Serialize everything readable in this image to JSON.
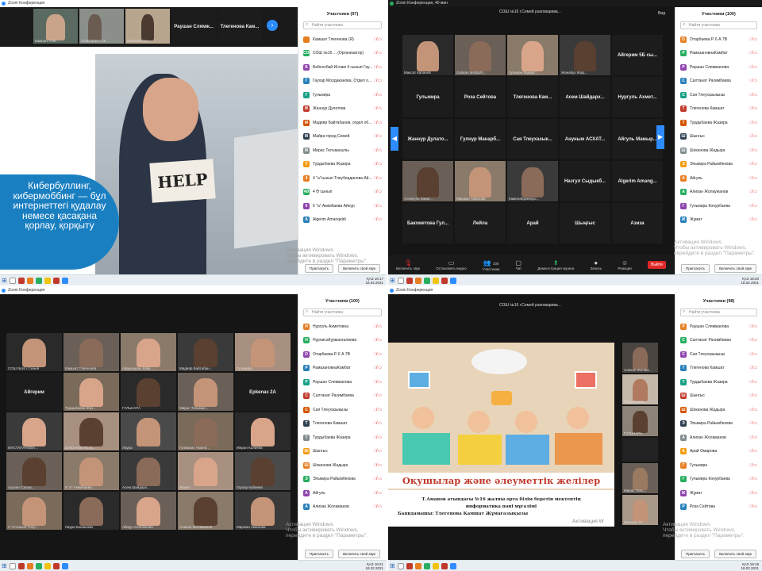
{
  "q1": {
    "title": "Zoom Конференция",
    "strip": [
      "Камшат Тлег...",
      "СОШ №16 г.Се...",
      "Исатаев Сул..."
    ],
    "strip_names": [
      "Раушан Слямж...",
      "Тлегенова Кам..."
    ],
    "slide_text": "Кибербуллинг, кибермоббинг — бұл интернеттегі қудалау немесе қасақана қорлау, қорқыту",
    "help": "HELP",
    "panel_title": "Участники (97)",
    "search": "Найти участника",
    "participants": [
      "Камшат Тлегенова (Я)",
      "СОШ №16 ... (Организатор)",
      "Бейсенбай Ислам 4 сынып Гау...",
      "Гаухар Молдаканова, Отдел о...",
      "Гульмира",
      "Жаннур Дулатова",
      "Мадияр Байтабанов, отдел об...",
      "Майра город Семей",
      "Мирас Телъманулы",
      "Турдыбаева Жазира",
      "4 \"а\"сынып Тлеубердинова Ай...",
      "4 Ә сынып",
      "6 \"а\" Акимбаева Айнур",
      "Algerim Amanqeldi"
    ],
    "avatars": [
      "",
      "СОШ",
      "Б",
      "Г",
      "Г",
      "Ж",
      "М",
      "М",
      "М",
      "Т",
      "4",
      "4Ә",
      "6",
      "А"
    ],
    "btn_invite": "Пригласить",
    "btn_unmute": "Включить свой звук",
    "watermark": "Активация Windows\nЧтобы активировать Windows, перейдите в раздел \"Параметры\".",
    "time": "18:17",
    "date": "18.02.2021"
  },
  "q2": {
    "title": "Zoom Конференция, 40 мин",
    "header": "СОШ №16 г.Семей разговарива...",
    "view": "Вид",
    "panel_title": "Участники (100)",
    "search": "Найти участника",
    "tiles": [
      "Максат Капанов",
      "Gulstan Moldazh...",
      "Гульжан Кадирс...",
      "Жанабуз Жар...",
      "Айгерим 5Б сы...",
      "Гульмира",
      "Роза Сейтова",
      "Тлегенова Кам...",
      "Асем Шайдарх...",
      "Нургуль Ахмет...",
      "Жаннур Дулато...",
      "Гулнур Манарб...",
      "Сая Тлеухазык...",
      "Ануным АСХАТ...",
      "Айгуль Мамыр...",
      "Асемгуль Канат...",
      "Маржан Аманова",
      "КамилаЕрмекуы...",
      "Назгул Сыдыкб...",
      "Algerim Amang...",
      "Бакхметова Гул...",
      "Лейла",
      "Арай",
      "Шыңғыс",
      "Азиза"
    ],
    "page_left": "1/4",
    "page_right": "2/4",
    "participants": [
      "Отарбаева Р. 6 А 7В",
      "РамазановнаКамбат",
      "Раушан Слямжанова",
      "Салтанат Рахимбаева",
      "Сая Тлеухазыкызы",
      "Тлегенова Камшат",
      "Турдыбаева Жазира",
      "Шынгыс",
      "Шоканова Жадыра",
      "Эльмира Райымбекова",
      "Айгуль",
      "Алихан Жолаужанов",
      "Гульмира Конурбаева",
      "Жұмат"
    ],
    "avatars": [
      "О",
      "Р",
      "Р",
      "С",
      "С",
      "Т",
      "Т",
      "Ш",
      "Ш",
      "Э",
      "А",
      "А",
      "Г",
      "Ж"
    ],
    "controls": [
      "Включить звук",
      "Остановить видео",
      "Участники",
      "Чат",
      "Демонстрация экрана",
      "Запись",
      "Реакции"
    ],
    "participants_count": "100",
    "leave": "Выйти",
    "btn_invite": "Пригласить",
    "btn_unmute": "Включить свой звук",
    "watermark": "Активация Windows\nЧтобы активировать Windows, перейдите в раздел \"Параметры\".",
    "time": "18:20",
    "date": "18.02.2021"
  },
  "q3": {
    "title": "Zoom Конференция",
    "panel_title": "Участники (100)",
    "search": "Найти участника",
    "tiles": [
      "СОШ №16 г.Семей",
      "Камшат Тлегенова",
      "Айдынқызы Шам...",
      "Мадияр Байтабан...",
      "Гульмира",
      "Айгерим",
      "Турдыбаева Жаз...",
      "ГУЛЬНАРА",
      "Мирас Тельман...",
      "Ерkenaз 2А",
      "МУСТАПАНОВА...",
      "Бейсенбай Исла...",
      "Лаура",
      "Гулжанат Аманб...",
      "Имран Калиева",
      "Арухан Салык...",
      "6 \"а\" Акимбаева...",
      "Асем Шайдарх...",
      "Жанат",
      "Гаухар Кабиева",
      "4 \"а\"сынып Тлеу...",
      "Лаура Канашова",
      "Айнур Асилбекова",
      "Алихан Жоламанов",
      "Маржан Аманова"
    ],
    "participants": [
      "Нургуль Ахметовна",
      "НурнисаКурмангалиева",
      "Отарбаева Р. 6 А 7В",
      "РамазановнаКамбат",
      "Раушан Слямжанова",
      "Салтанат Рахимбаева",
      "Сая Тлеухазыкызы",
      "Тлегенова Камшат",
      "Турдыбаева Жазира",
      "Шынгыс",
      "Шоканова Жадыра",
      "Эльмира Райымбекова",
      "Айгуль",
      "Алихан Жоламанов"
    ],
    "avatars": [
      "Н",
      "Н",
      "О",
      "Р",
      "Р",
      "С",
      "С",
      "Т",
      "Т",
      "Ш",
      "Ш",
      "Э",
      "А",
      "А"
    ],
    "btn_invite": "Пригласить",
    "btn_unmute": "Включить свой звук",
    "watermark": "Активация Windows\nЧтобы активировать Windows, перейдите в раздел \"Параметры\".",
    "time": "18:21",
    "date": "18.02.2021"
  },
  "q4": {
    "title": "Zoom Конференция",
    "header": "СОШ №16 г.Семей разговарива...",
    "slide_title": "Оқушылар және әлеуметтік желілер",
    "slide_line1": "Т.Аманов атындағы №16 жалпы орта білім беретін мектептің",
    "slide_line2": "информатика пәні мұғалімі",
    "slide_line3": "Баяндамашы: Тлегенова Камшат Жұмағазықызы",
    "side": [
      "Алихан Жолам...",
      "Турдыбаева...",
      "ГУЛЬНАРА",
      "",
      "Мирас Тель...",
      "Еркеназ 2А"
    ],
    "panel_title": "Участники (98)",
    "search": "Найти участника",
    "participants": [
      "Раушан Слямжанова",
      "Салтанат Рахимбаева",
      "Сая Тлеухазыкызы",
      "Тлегенова Камшат",
      "Турдыбаева Жазира",
      "Шынгыс",
      "Шоканова Жадыра",
      "Эльмира Райымбекова",
      "Алихан Жоламанов",
      "Арай Омарова",
      "Гульмира",
      "Гульмира Конурбаева",
      "Жұмат",
      "Роза Сейтова"
    ],
    "avatars": [
      "Р",
      "С",
      "С",
      "Т",
      "Т",
      "Ш",
      "Ш",
      "Э",
      "А",
      "А",
      "Г",
      "Г",
      "Ж",
      "Р"
    ],
    "btn_invite": "Пригласить",
    "btn_unmute": "Включить свой звук",
    "watermark": "Активация Windows\nЧтобы активировать Windows, перейдите в раздел \"Параметры\".",
    "watermark2": "Активация W",
    "time": "18:19",
    "date": "18.02.2021"
  },
  "taskbar_lang": "ҚАЗ",
  "colors": {
    "zoom_blue": "#2d8cff",
    "mute_red": "#e02828",
    "slide_blue": "#1a7fc1"
  }
}
